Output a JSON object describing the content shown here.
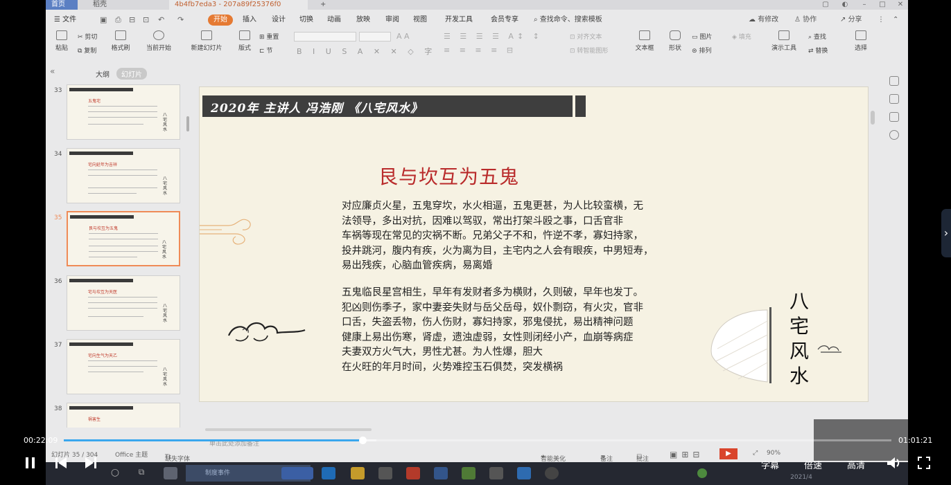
{
  "app": {
    "home_tab": "首页",
    "app_tab": "稻壳",
    "doc_tab": "4b4fb7eda3 - 207a89f25376f0"
  },
  "menu": {
    "file": "文件",
    "items": [
      "开始",
      "插入",
      "设计",
      "切换",
      "动画",
      "放映",
      "审阅",
      "视图",
      "开发工具",
      "会员专享"
    ],
    "active": "开始",
    "search": "查找命令、搜索模板",
    "right_items": [
      "有修改",
      "协作",
      "分享"
    ]
  },
  "ribbon": {
    "paste": "粘贴",
    "cut": "剪切",
    "copy": "复制",
    "format_painter": "格式刷",
    "from_current": "当前开始",
    "new_slide": "新建幻灯片",
    "layout": "版式",
    "section": "节",
    "reset": "重置",
    "textbox": "文本框",
    "shape": "形状",
    "picture": "图片",
    "arrange": "排列",
    "fill": "填充",
    "presenter_tools": "演示工具",
    "find": "查找",
    "replace": "替换",
    "select": "选择",
    "text_align": "对齐文本",
    "smart_convert": "转智能图形"
  },
  "thumbpanel": {
    "outline_tab": "大纲",
    "slides_tab": "幻灯片",
    "slides": [
      {
        "number": "33",
        "title": "五鬼宅"
      },
      {
        "number": "34",
        "title": "宅向延年为吉祥"
      },
      {
        "number": "35",
        "title": "艮与坎互为五鬼"
      },
      {
        "number": "36",
        "title": "宅与坎互为天医"
      },
      {
        "number": "37",
        "title": "宅向生气为天乙"
      },
      {
        "number": "38",
        "title": "祸害生"
      }
    ],
    "side_text": "八宅风水"
  },
  "slide": {
    "banner": "2020年 主讲人 冯浩刚 《八宅风水》",
    "heading": "艮与坎互为五鬼",
    "para1": [
      "对应廉贞火星，五鬼穿坎，水火相逼，五鬼更甚，为人比较蛮横，无",
      "法领导，多出对抗，因难以驾驭，常出打架斗殴之事，口舌官非",
      "车祸等现在常见的灾祸不断。兄弟父子不和，忤逆不孝，寡妇持家，",
      "投井跳河，腹内有疾，火为离为目，主宅内之人会有眼疾，中男短寿，",
      "易出残疾，心脑血管疾病，易离婚"
    ],
    "para2": [
      "五鬼临艮星宫相生，早年有发财者多为横财，久则破，早年也发丁。",
      "犯凶则伤季子，家中妻妾失财与岳父岳母，奴仆剽窃，有火灾，官非",
      "口舌，失盗丢物，伤人伤财，寡妇持家，邪鬼侵扰，易出精神问题",
      "健康上易出伤寒，肾虚，遗浊虚弱，女性则闭经小产，血崩等病症",
      "夫妻双方火气大，男性尤甚。为人性爆，胆大",
      "在火旺的年月时间，火势难控玉石俱焚，突发横祸"
    ],
    "vertical_title": [
      "八",
      "宅",
      "风",
      "水"
    ]
  },
  "statusbar": {
    "slide_info": "幻灯片 35 / 304",
    "theme": "Office 主题",
    "font_missing": "缺失字体",
    "beautify": "智能美化",
    "notes": "备注",
    "comments": "批注",
    "zoom": "90%",
    "notes_hint": "单击此处添加备注"
  },
  "taskbar": {
    "task1": "制度事件",
    "clock_date": "2021/4"
  },
  "player": {
    "current_time": "00:22:09",
    "total_time": "01:01:21",
    "progress": 0.361,
    "buffered": 0.378,
    "subtitles": "字幕",
    "speed": "倍速",
    "quality": "高清"
  },
  "colors": {
    "accent_orange": "#e57a33",
    "heading_red": "#b92b2b",
    "progress_blue": "#39a7ee",
    "selected_border": "#ef8a56"
  }
}
